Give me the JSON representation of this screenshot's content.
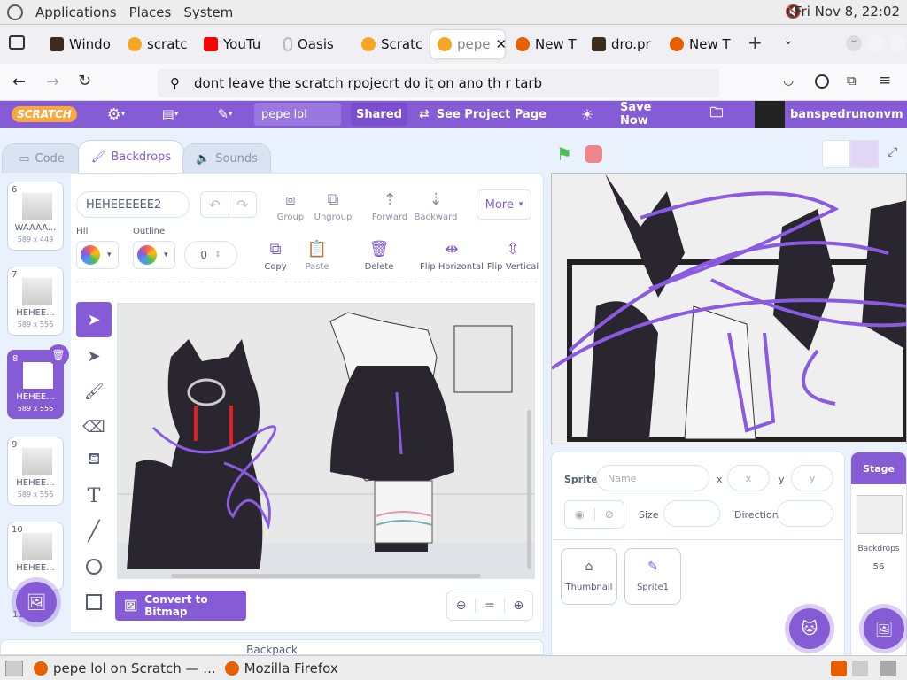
{
  "gnome": {
    "menu": [
      "Applications",
      "Places",
      "System"
    ],
    "clock": "Fri Nov  8, 22:02"
  },
  "browser": {
    "tabs": [
      {
        "label": "Windo",
        "icon": "window-icon"
      },
      {
        "label": "scratc",
        "icon": "scratch-icon"
      },
      {
        "label": "YouTu",
        "icon": "youtube-icon"
      },
      {
        "label": "Oasis",
        "icon": "oasis-icon"
      },
      {
        "label": "Scratc",
        "icon": "scratch-icon"
      },
      {
        "label": "pepe",
        "icon": "scratch-icon"
      },
      {
        "label": "New T",
        "icon": "firefox-icon"
      },
      {
        "label": "dro.pr",
        "icon": "window-icon"
      },
      {
        "label": "New T",
        "icon": "firefox-icon"
      }
    ],
    "url_text": "dont leave the scratch rpojecrt do it on ano th r tarb"
  },
  "scratch": {
    "logo": "SCRATCH",
    "project_title": "pepe lol",
    "shared_label": "Shared",
    "see_project_label": "See Project Page",
    "save_label": "Save Now",
    "username": "banspedrunonvm",
    "tabs": {
      "code": "Code",
      "backdrops": "Backdrops",
      "sounds": "Sounds"
    },
    "costume_name": "HEHEEEEEE2",
    "fill_label": "Fill",
    "outline_label": "Outline",
    "outline_width": "0",
    "toolbar": {
      "group": "Group",
      "ungroup": "Ungroup",
      "forward": "Forward",
      "backward": "Backward",
      "more": "More",
      "copy": "Copy",
      "paste": "Paste",
      "delete": "Delete",
      "flip_h": "Flip Horizontal",
      "flip_v": "Flip Vertical"
    },
    "convert_label": "Convert to Bitmap",
    "zoom_reset": "=",
    "backpack": "Backpack",
    "costumes": [
      {
        "num": "6",
        "name": "WAAAA...",
        "size": "589 x 449"
      },
      {
        "num": "7",
        "name": "HEHEE...",
        "size": "589 x 556"
      },
      {
        "num": "8",
        "name": "HEHEE...",
        "size": "589 x 556"
      },
      {
        "num": "9",
        "name": "HEHEE...",
        "size": "589 x 556"
      },
      {
        "num": "10",
        "name": "HEHEE...",
        "size": ""
      },
      {
        "num": "11",
        "name": "",
        "size": ""
      }
    ],
    "sprite_info": {
      "sprite_label": "Sprite",
      "name_placeholder": "Name",
      "x_label": "x",
      "x_placeholder": "x",
      "y_label": "y",
      "y_placeholder": "y",
      "size_label": "Size",
      "direction_label": "Direction"
    },
    "sprites": [
      "Thumbnail",
      "Sprite1"
    ],
    "stage_panel": {
      "title": "Stage",
      "backdrops_label": "Backdrops",
      "backdrops_count": "56"
    }
  },
  "taskbar": {
    "items": [
      "pepe lol on Scratch — ...",
      "Mozilla Firefox"
    ]
  },
  "colors": {
    "scratch_purple": "#855cd6",
    "blue": "#4c97ff"
  }
}
